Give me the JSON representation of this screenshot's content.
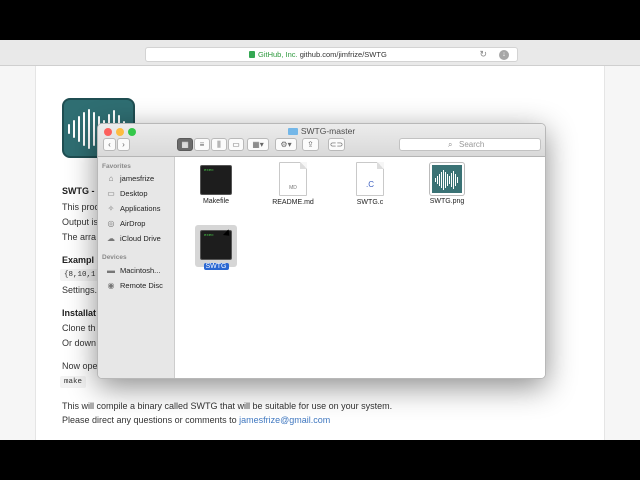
{
  "browser": {
    "url_org": "GitHub, Inc.",
    "url": "github.com/jimfrize/SWTG"
  },
  "page": {
    "heading": "SWTG -",
    "lines": [
      "This proc",
      "Output is",
      "The arra"
    ],
    "example_heading": "Exampl",
    "example_code": "{8,10,1",
    "example_line": "Settings.",
    "install_heading": "Installat",
    "install_lines": [
      "Clone th",
      "Or down"
    ],
    "now_open": "Now ope",
    "make_code": "make",
    "compile_line": "This will compile a binary called SWTG that will be suitable for use on your system.",
    "contact_prefix": "Please direct any questions or comments to ",
    "contact_email": "jamesfrize@gmail.com"
  },
  "finder": {
    "title": "SWTG-master",
    "search_placeholder": "Search",
    "favorites_heading": "Favorites",
    "favorites": [
      {
        "label": "jamesfrize",
        "icon": "home-icon"
      },
      {
        "label": "Desktop",
        "icon": "desktop-icon"
      },
      {
        "label": "Applications",
        "icon": "applications-icon"
      },
      {
        "label": "AirDrop",
        "icon": "airdrop-icon"
      },
      {
        "label": "iCloud Drive",
        "icon": "cloud-icon"
      }
    ],
    "devices_heading": "Devices",
    "devices": [
      {
        "label": "Macintosh...",
        "icon": "hard-drive-icon"
      },
      {
        "label": "Remote Disc",
        "icon": "disc-icon"
      }
    ],
    "files": [
      {
        "name": "Makefile",
        "type": "exec",
        "badge": "exec"
      },
      {
        "name": "README.md",
        "type": "doc",
        "badge": "MD"
      },
      {
        "name": "SWTG.c",
        "type": "doc",
        "badge": ".C"
      },
      {
        "name": "SWTG.png",
        "type": "image"
      },
      {
        "name": "SWTG",
        "type": "exec",
        "badge": "exec",
        "selected": true
      }
    ]
  },
  "colors": {
    "selection": "#2a67d2",
    "link": "#4078c0",
    "logo": "#2f6e72"
  }
}
